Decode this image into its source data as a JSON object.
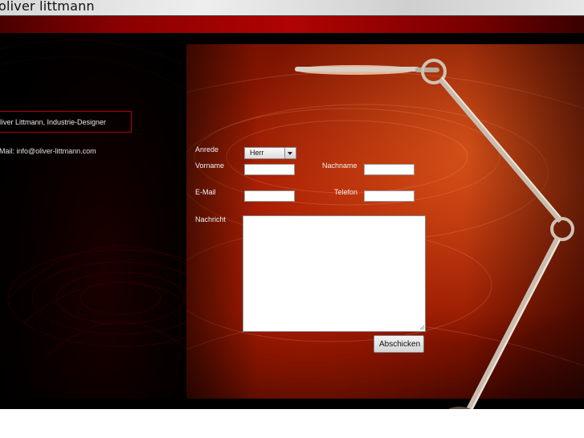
{
  "header": {
    "brand": "oliver littmann"
  },
  "sidebar": {
    "name_title": "liver Littmann, Industrie-Designer",
    "email_line": "Mail: info@oliver-littmann.com"
  },
  "form": {
    "anrede_label": "Anrede",
    "anrede_value": "Herr",
    "vorname_label": "Vorname",
    "vorname_value": "",
    "nachname_label": "Nachname",
    "nachname_value": "",
    "email_label": "E-Mail",
    "email_value": "",
    "telefon_label": "Telefon",
    "telefon_value": "",
    "nachricht_label": "Nachricht",
    "nachricht_value": "",
    "submit_label": "Abschicken"
  },
  "colors": {
    "accent_red": "#b30000",
    "background": "#050000",
    "panel_orange": "#a32005"
  }
}
